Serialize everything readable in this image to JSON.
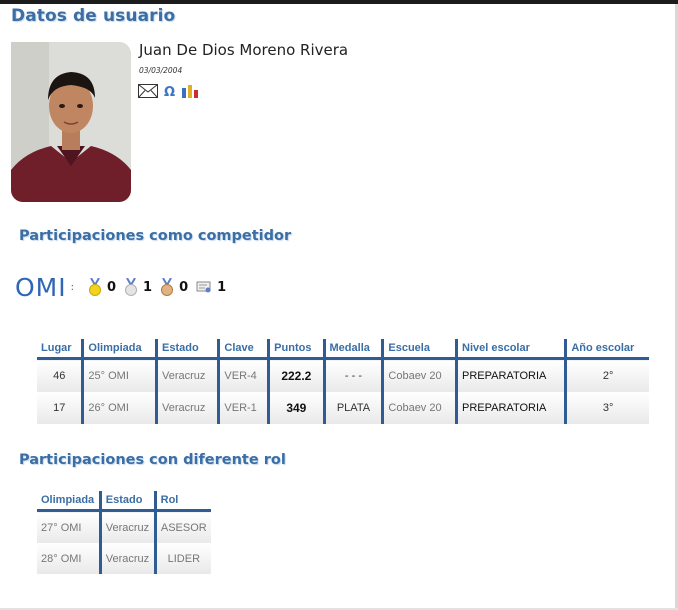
{
  "page": {
    "title": "Datos de usuario"
  },
  "user": {
    "name": "Juan De Dios Moreno Rivera",
    "birth_date": "03/03/2004",
    "icons": [
      "mail-icon",
      "omegaup-icon",
      "stats-icon"
    ]
  },
  "competitor": {
    "heading": "Participaciones como competidor",
    "logo": "OMI",
    "colon": ":",
    "medals": {
      "gold": "0",
      "silver": "1",
      "bronze": "0",
      "mention": "1"
    },
    "columns": [
      "Lugar",
      "Olimpiada",
      "Estado",
      "Clave",
      "Puntos",
      "Medalla",
      "Escuela",
      "Nivel escolar",
      "Año escolar"
    ],
    "rows": [
      [
        "46",
        "25° OMI",
        "Veracruz",
        "VER-4",
        "222.2",
        "- - -",
        "Cobaev 20",
        "PREPARATORIA",
        "2°"
      ],
      [
        "17",
        "26° OMI",
        "Veracruz",
        "VER-1",
        "349",
        "PLATA",
        "Cobaev 20",
        "PREPARATORIA",
        "3°"
      ]
    ]
  },
  "roles": {
    "heading": "Participaciones con diferente rol",
    "columns": [
      "Olimpiada",
      "Estado",
      "Rol"
    ],
    "rows": [
      [
        "27° OMI",
        "Veracruz",
        "ASESOR"
      ],
      [
        "28° OMI",
        "Veracruz",
        "LIDER"
      ]
    ]
  },
  "colors": {
    "accent": "#3a6ea5",
    "border": "#2e5c93",
    "logo": "#2f66b5"
  }
}
